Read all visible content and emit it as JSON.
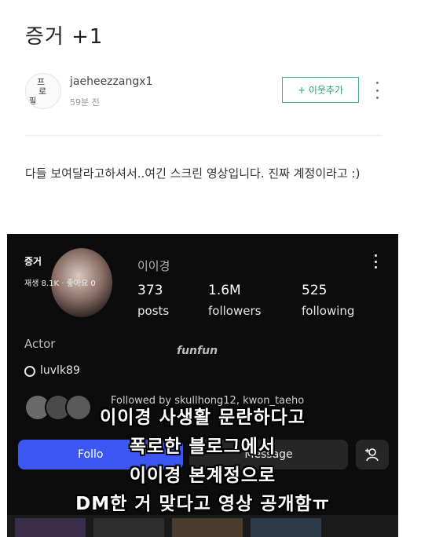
{
  "post": {
    "title": "증거 +1",
    "author": "jaeheezzangx1",
    "time": "59분 전",
    "follow_label": "+ 이웃추가",
    "avatar_alt": {
      "a": "프",
      "b": "로",
      "c": "필"
    },
    "body": "다들 보여달라고하셔서..여긴 스크린 영상입니다. 진짜 계정이라고 :)"
  },
  "video": {
    "overlay_title": "증거",
    "overlay_stats": "재생 8.1K · 좋아요 0",
    "username": "이이경",
    "stats": [
      {
        "num": "373",
        "label": "posts"
      },
      {
        "num": "1.6M",
        "label": "followers"
      },
      {
        "num": "525",
        "label": "following"
      }
    ],
    "bio": "Actor",
    "watermark": "funfun",
    "threads": "luvlk89",
    "followed_by": "Followed by skullhong12, kwon_taeho",
    "follow_btn": "Follo",
    "message_btn": "Message",
    "captions": [
      "이이경 사생활 문란하다고",
      "폭로한 블로그에서",
      "이이경 본계정으로",
      "DM한 거 맞다고 영상 공개함ㅠ"
    ],
    "icons": {
      "more": "more-vertical-icon",
      "add_person": "add-person-icon",
      "threads": "threads-icon"
    }
  },
  "colors": {
    "accent_green": "#2f9e78",
    "ig_blue": "#3c56f2"
  }
}
